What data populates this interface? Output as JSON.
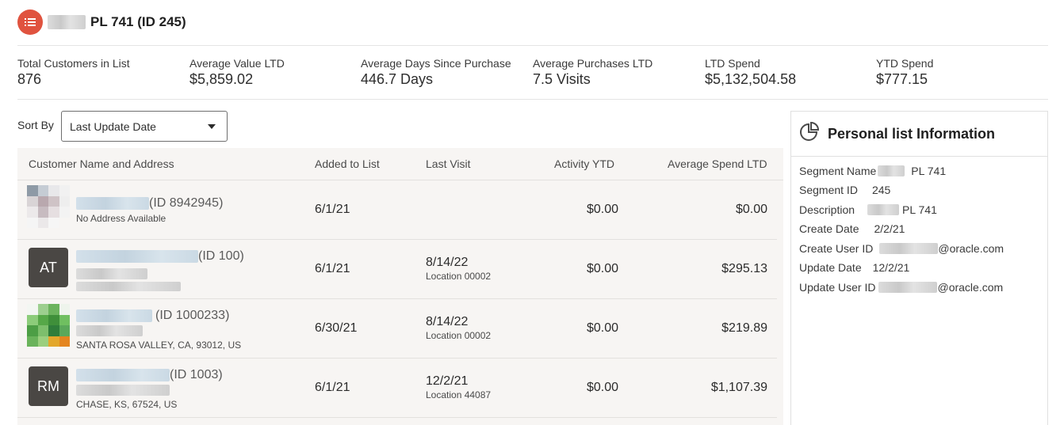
{
  "header": {
    "title": "PL 741 (ID 245)",
    "icon": "list-icon"
  },
  "metrics": [
    {
      "label": "Total Customers in List",
      "value": "876"
    },
    {
      "label": "Average Value LTD",
      "value": "$5,859.02"
    },
    {
      "label": "Average Days Since Purchase",
      "value": "446.7 Days"
    },
    {
      "label": "Average Purchases LTD",
      "value": "7.5 Visits"
    },
    {
      "label": "LTD Spend",
      "value": "$5,132,504.58"
    },
    {
      "label": "YTD Spend",
      "value": "$777.15"
    }
  ],
  "sort": {
    "label": "Sort By",
    "selected": "Last Update Date"
  },
  "table": {
    "columns": [
      "Customer Name and Address",
      "Added to List",
      "Last Visit",
      "Activity YTD",
      "Average Spend LTD"
    ],
    "rows": [
      {
        "avatar": "",
        "id": "(ID 8942945)",
        "address": "No Address Available",
        "added": "6/1/21",
        "last_visit": "",
        "location": "",
        "activity": "$0.00",
        "avg_spend": "$0.00"
      },
      {
        "avatar": "AT",
        "id": "(ID 100)",
        "address": "",
        "added": "6/1/21",
        "last_visit": "8/14/22",
        "location": "Location 00002",
        "activity": "$0.00",
        "avg_spend": "$295.13"
      },
      {
        "avatar": "",
        "id": "(ID 1000233)",
        "address": "SANTA ROSA VALLEY, CA, 93012, US",
        "added": "6/30/21",
        "last_visit": "8/14/22",
        "location": "Location 00002",
        "activity": "$0.00",
        "avg_spend": "$219.89"
      },
      {
        "avatar": "RM",
        "id": "(ID 1003)",
        "address": "CHASE, KS, 67524, US",
        "added": "6/1/21",
        "last_visit": "12/2/21",
        "location": "Location 44087",
        "activity": "$0.00",
        "avg_spend": "$1,107.39"
      }
    ]
  },
  "panel": {
    "title": "Personal list Information",
    "icon": "pie-chart-icon",
    "fields": [
      {
        "label": "Segment Name",
        "value": "PL 741"
      },
      {
        "label": "Segment ID",
        "value": "245"
      },
      {
        "label": "Description",
        "value": "PL 741"
      },
      {
        "label": "Create Date",
        "value": "2/2/21"
      },
      {
        "label": "Create User ID",
        "value": "@oracle.com"
      },
      {
        "label": "Update Date",
        "value": "12/2/21"
      },
      {
        "label": "Update User ID",
        "value": "@oracle.com"
      }
    ]
  },
  "colors": {
    "accent": "#e0533f",
    "avatar_bg": "#4a4744",
    "table_bg": "#f7f5f3"
  }
}
